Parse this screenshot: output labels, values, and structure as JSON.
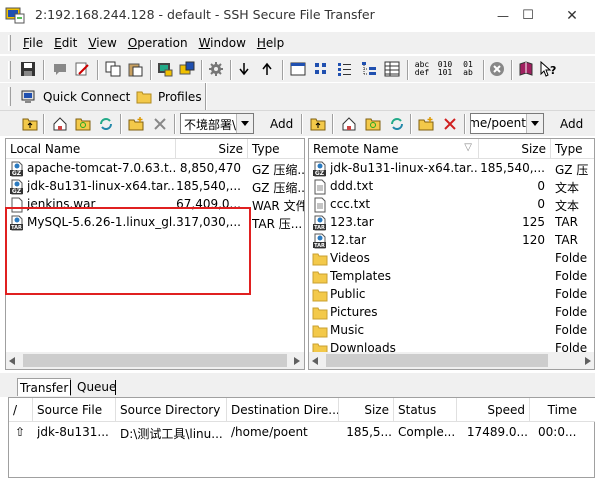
{
  "window": {
    "title": "2:192.168.244.128 - default - SSH Secure File Transfer",
    "minimize_glyph": "—",
    "maximize_glyph": "☐",
    "close_glyph": "✕"
  },
  "menu": {
    "items": [
      {
        "key": "F",
        "rest": "ile"
      },
      {
        "key": "E",
        "rest": "dit"
      },
      {
        "key": "V",
        "rest": "iew"
      },
      {
        "key": "O",
        "rest": "peration"
      },
      {
        "key": "W",
        "rest": "indow"
      },
      {
        "key": "H",
        "rest": "elp"
      }
    ]
  },
  "toolbar": {
    "quick_connect": "Quick Connect",
    "profiles": "Profiles",
    "binary_label_top": "010",
    "binary_label_bottom": "101",
    "text_label_top": "abc",
    "text_label_bottom": "def",
    "auto_label_top": "01",
    "auto_label_bottom": "ab"
  },
  "local": {
    "path": "不境部署\\",
    "add_label": "Add",
    "headers": {
      "name": "Local Name",
      "size": "Size",
      "type": "Type"
    },
    "files": [
      {
        "name": "apache-tomcat-7.0.63.t...",
        "size": "8,850,470",
        "type": "GZ 压缩...",
        "icon": "gz-archive-icon"
      },
      {
        "name": "jdk-8u131-linux-x64.tar....",
        "size": "185,540,...",
        "type": "GZ 压缩...",
        "icon": "gz-archive-icon"
      },
      {
        "name": "jenkins.war",
        "size": "67,409,0...",
        "type": "WAR 文件",
        "icon": "file-icon"
      },
      {
        "name": "MySQL-5.6.26-1.linux_gl...",
        "size": "317,030,...",
        "type": "TAR 压...",
        "icon": "tar-archive-icon"
      }
    ]
  },
  "remote": {
    "path": "/home/poent",
    "add_label": "Add",
    "headers": {
      "name": "Remote Name",
      "size": "Size",
      "type": "Type"
    },
    "files": [
      {
        "name": "jdk-8u131-linux-x64.tar....",
        "size": "185,540,...",
        "type": "GZ 压",
        "icon": "gz-archive-icon"
      },
      {
        "name": "ddd.txt",
        "size": "0",
        "type": "文本",
        "icon": "text-file-icon"
      },
      {
        "name": "ccc.txt",
        "size": "0",
        "type": "文本",
        "icon": "text-file-icon"
      },
      {
        "name": "123.tar",
        "size": "125",
        "type": "TAR",
        "icon": "tar-archive-icon"
      },
      {
        "name": "12.tar",
        "size": "120",
        "type": "TAR",
        "icon": "tar-archive-icon"
      },
      {
        "name": "Videos",
        "size": "",
        "type": "Folde",
        "icon": "folder-icon"
      },
      {
        "name": "Templates",
        "size": "",
        "type": "Folde",
        "icon": "folder-icon"
      },
      {
        "name": "Public",
        "size": "",
        "type": "Folde",
        "icon": "folder-icon"
      },
      {
        "name": "Pictures",
        "size": "",
        "type": "Folde",
        "icon": "folder-icon"
      },
      {
        "name": "Music",
        "size": "",
        "type": "Folde",
        "icon": "folder-icon"
      },
      {
        "name": "Downloads",
        "size": "",
        "type": "Folde",
        "icon": "folder-icon"
      }
    ]
  },
  "transfer": {
    "tabs": [
      "Transfer",
      "Queue"
    ],
    "headers": {
      "dir": "/",
      "source_file": "Source File",
      "source_directory": "Source Directory",
      "destination": "Destination Dire...",
      "size": "Size",
      "status": "Status",
      "speed": "Speed",
      "time": "Time"
    },
    "rows": [
      {
        "dir": "⇧",
        "source_file": "jdk-8u131...",
        "source_directory": "D:\\测试工具\\linu...",
        "destination": "/home/poent",
        "size": "185,5...",
        "status": "Comple...",
        "speed": "17489.0...",
        "time": "00:0..."
      }
    ]
  },
  "colors": {
    "folder": "#f3c94a",
    "highlight_box": "#e02020",
    "window_bg": "#f0f0f0"
  }
}
